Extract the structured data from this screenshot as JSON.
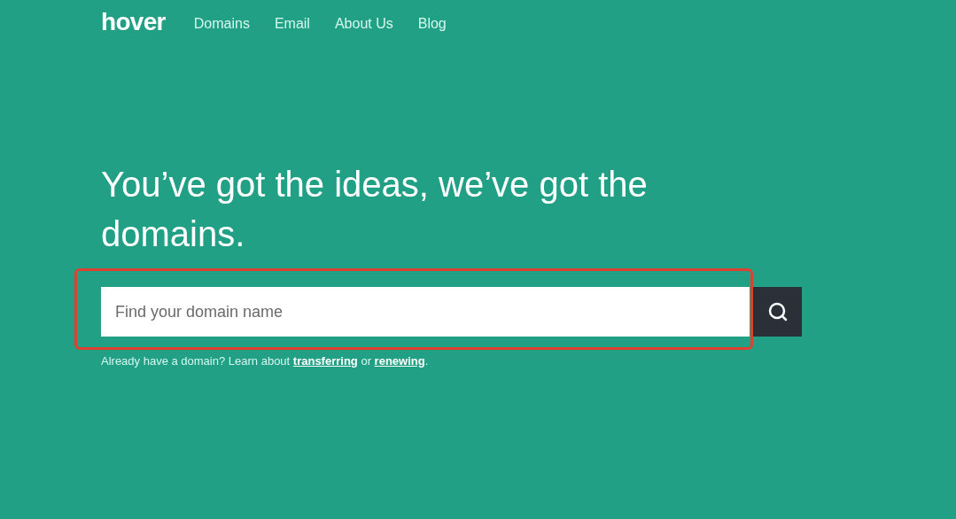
{
  "nav": {
    "logo": "hover",
    "links": [
      "Domains",
      "Email",
      "About Us",
      "Blog"
    ]
  },
  "hero": {
    "heading": "You’ve got the ideas, we’ve got the domains.",
    "search": {
      "placeholder": "Find your domain name",
      "highlighted": true
    },
    "helper": [
      {
        "kind": "text",
        "text": "Already have a domain? Learn about "
      },
      {
        "kind": "link",
        "text": "transferring"
      },
      {
        "kind": "text",
        "text": " or "
      },
      {
        "kind": "link",
        "text": "renewing"
      },
      {
        "kind": "text",
        "text": "."
      }
    ]
  }
}
